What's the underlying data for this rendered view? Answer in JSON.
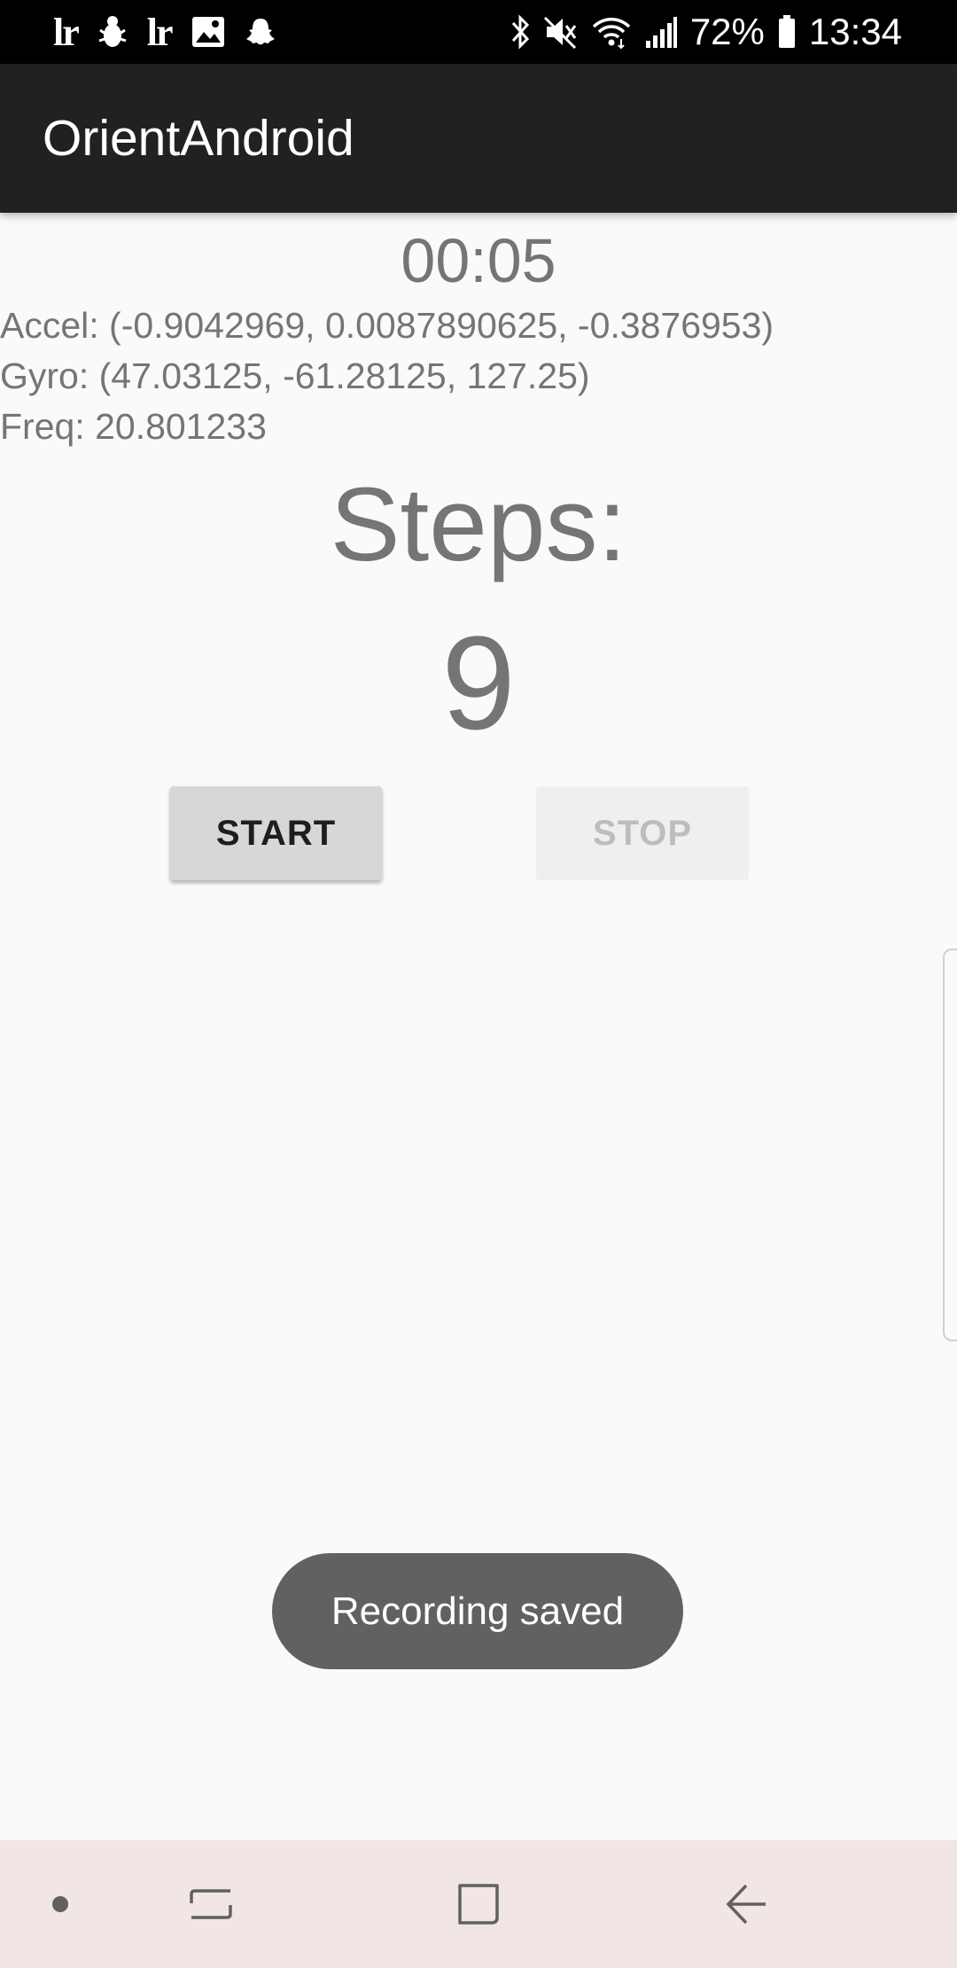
{
  "status_bar": {
    "notification_icons": [
      "lightroom-icon",
      "bug-icon",
      "lightroom-icon",
      "image-icon",
      "snapchat-icon"
    ],
    "system_icons": [
      "bluetooth-icon",
      "mute-icon",
      "wifi-icon",
      "signal-icon",
      "battery-icon"
    ],
    "battery_percent": "72%",
    "time": "13:34"
  },
  "app_bar": {
    "title": "OrientAndroid"
  },
  "main": {
    "timer": "00:05",
    "accel": "Accel: (-0.9042969, 0.0087890625, -0.3876953)",
    "gyro": "Gyro: (47.03125, -61.28125, 127.25)",
    "freq": "Freq: 20.801233",
    "steps_label": "Steps:",
    "steps_value": "9",
    "start_label": "START",
    "stop_label": "STOP"
  },
  "toast": {
    "message": "Recording saved"
  },
  "nav_bar": {
    "items": [
      "dot-icon",
      "recents-icon",
      "home-icon",
      "back-icon"
    ]
  },
  "colors": {
    "status_bar_bg": "#000000",
    "app_bar_bg": "#212121",
    "content_bg": "#fafafa",
    "text_gray": "#757575",
    "toast_bg": "#616161",
    "nav_bar_bg": "#f1e5e5"
  }
}
